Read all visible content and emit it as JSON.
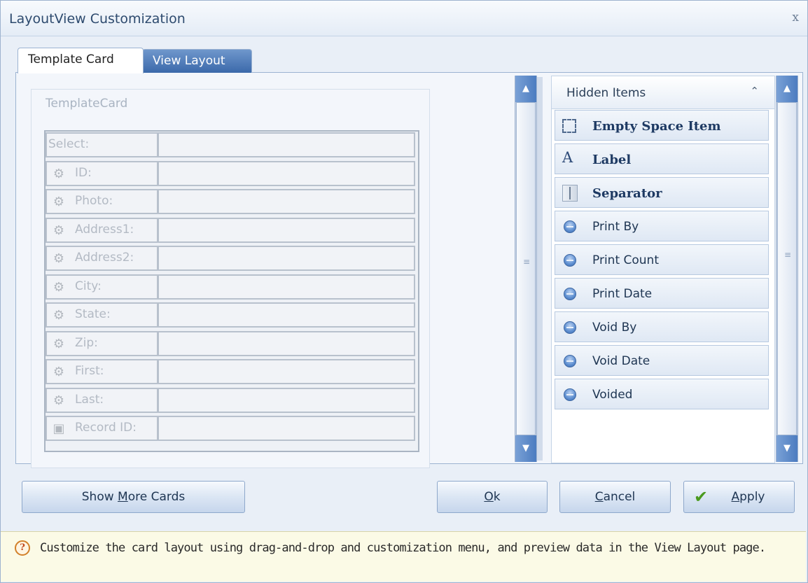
{
  "window": {
    "title": "LayoutView Customization",
    "close": "x"
  },
  "tabs": [
    {
      "label": "Template Card",
      "active": true
    },
    {
      "label": "View Layout",
      "active": false
    }
  ],
  "template_card": {
    "group_title": "TemplateCard",
    "fields": [
      {
        "label": "Select:",
        "icon": "none"
      },
      {
        "label": "ID:",
        "icon": "key-field-icon"
      },
      {
        "label": "Photo:",
        "icon": "key-field-icon"
      },
      {
        "label": "Address1:",
        "icon": "key-field-icon"
      },
      {
        "label": "Address2:",
        "icon": "key-field-icon"
      },
      {
        "label": "City:",
        "icon": "key-field-icon"
      },
      {
        "label": "State:",
        "icon": "key-field-icon"
      },
      {
        "label": "Zip:",
        "icon": "key-field-icon"
      },
      {
        "label": "First:",
        "icon": "key-field-icon"
      },
      {
        "label": "Last:",
        "icon": "key-field-icon"
      },
      {
        "label": "Record ID:",
        "icon": "lock-field-icon"
      }
    ]
  },
  "hidden_items": {
    "title": "Hidden Items",
    "items": [
      {
        "label": "Empty Space Item",
        "icon": "empty-space-icon",
        "bold": true
      },
      {
        "label": "Label",
        "icon": "text-label-icon",
        "bold": true
      },
      {
        "label": "Separator",
        "icon": "separator-icon",
        "bold": true
      },
      {
        "label": "Print By",
        "icon": "field-icon",
        "bold": false
      },
      {
        "label": "Print Count",
        "icon": "field-icon",
        "bold": false
      },
      {
        "label": "Print Date",
        "icon": "field-icon",
        "bold": false
      },
      {
        "label": "Void By",
        "icon": "field-icon",
        "bold": false
      },
      {
        "label": "Void Date",
        "icon": "field-icon",
        "bold": false
      },
      {
        "label": "Voided",
        "icon": "field-icon",
        "bold": false
      }
    ]
  },
  "buttons": {
    "show_more_pre": "Show ",
    "show_more_ul": "M",
    "show_more_post": "ore Cards",
    "ok_ul": "O",
    "ok_post": "k",
    "cancel_ul": "C",
    "cancel_post": "ancel",
    "apply_ul": "A",
    "apply_post": "pply"
  },
  "hint": {
    "text": "Customize the card layout using drag-and-drop and customization menu, and preview data in the View Layout page."
  },
  "colors": {
    "accent": "#4c7cc0",
    "tab_inactive": "#3b69aa",
    "hint_bg": "#fbfae6"
  }
}
